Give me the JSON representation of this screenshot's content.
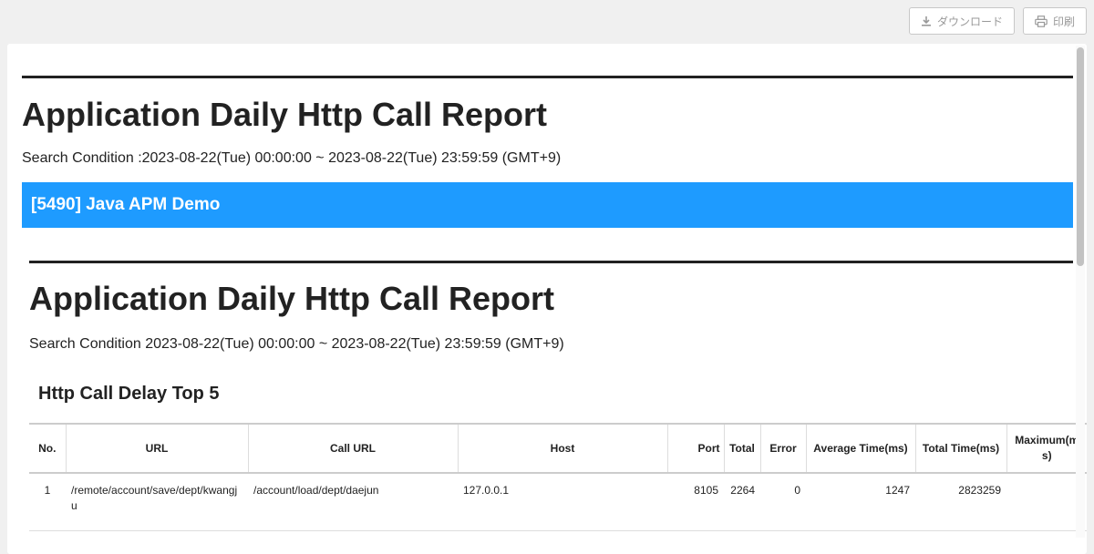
{
  "toolbar": {
    "download_label": "ダウンロード",
    "print_label": "印刷"
  },
  "report": {
    "title": "Application Daily Http Call Report",
    "condition": "Search Condition :2023-08-22(Tue) 00:00:00 ~ 2023-08-22(Tue) 23:59:59 (GMT+9)",
    "app_header": "[5490] Java APM Demo",
    "inner_title": "Application Daily Http Call Report",
    "inner_condition": "Search Condition 2023-08-22(Tue) 00:00:00 ~ 2023-08-22(Tue) 23:59:59 (GMT+9)",
    "section_title": "Http Call Delay Top 5"
  },
  "table": {
    "headers": {
      "no": "No.",
      "url": "URL",
      "call_url": "Call URL",
      "host": "Host",
      "port": "Port",
      "total": "Total",
      "error": "Error",
      "avg_time": "Average Time(ms)",
      "total_time": "Total Time(ms)",
      "max": "Maximum(ms)"
    },
    "rows": [
      {
        "no": "1",
        "url": "/remote/account/save/dept/kwangju",
        "call_url": "/account/load/dept/daejun",
        "host": "127.0.0.1",
        "port": "8105",
        "total": "2264",
        "error": "0",
        "avg_time": "1247",
        "total_time": "2823259",
        "max": ""
      }
    ]
  },
  "colors": {
    "accent": "#1e9bff",
    "text": "#222222"
  }
}
